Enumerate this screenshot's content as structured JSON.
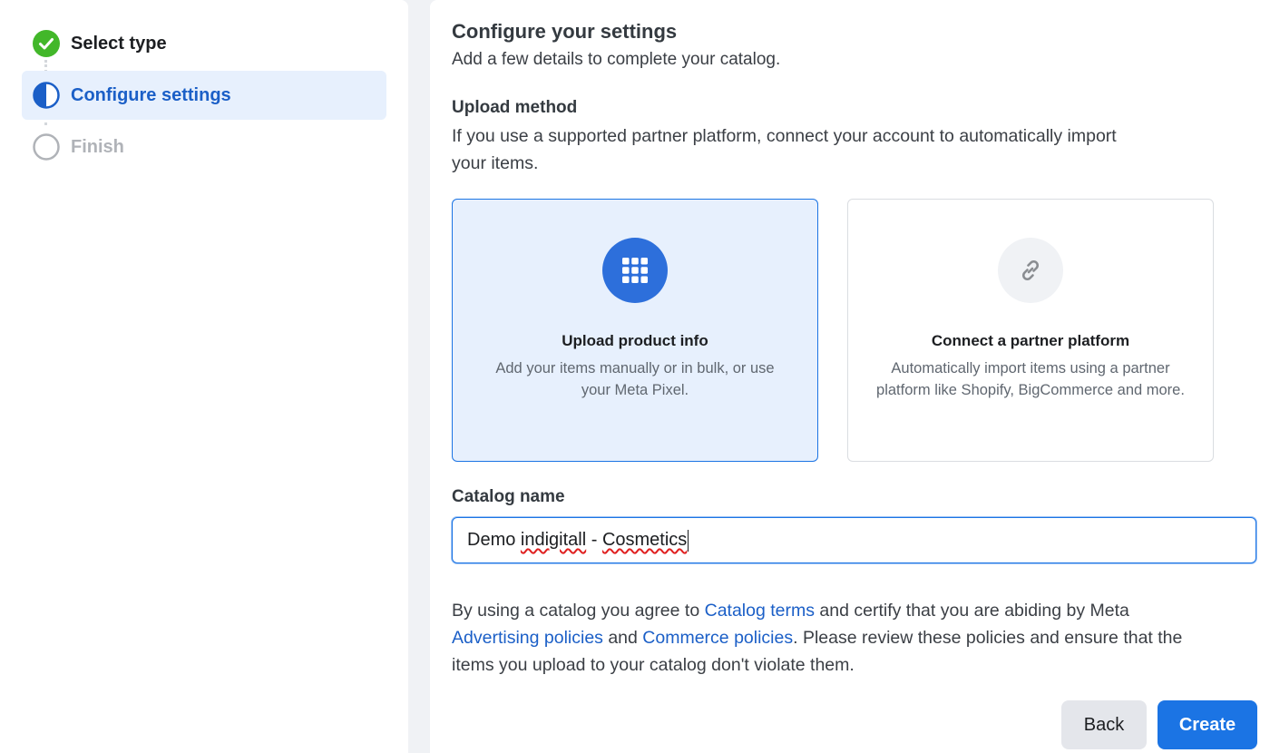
{
  "stepper": {
    "steps": [
      {
        "label": "Select type",
        "state": "done",
        "icon": "check-circle-icon"
      },
      {
        "label": "Configure settings",
        "state": "active",
        "icon": "half-circle-icon"
      },
      {
        "label": "Finish",
        "state": "todo",
        "icon": "empty-circle-icon"
      }
    ]
  },
  "main": {
    "title": "Configure your settings",
    "subtitle": "Add a few details to complete your catalog.",
    "upload_method": {
      "label": "Upload method",
      "description_line1": "If you use a supported partner platform, connect your account to automatically import",
      "description_line2": "your items.",
      "options": [
        {
          "title": "Upload product info",
          "description": "Add your items manually or in bulk, or use your Meta Pixel.",
          "icon": "grid-icon",
          "selected": true
        },
        {
          "title": "Connect a partner platform",
          "description": "Automatically import items using a partner platform like Shopify, BigCommerce and more.",
          "icon": "link-icon",
          "selected": false
        }
      ]
    },
    "catalog_name": {
      "label": "Catalog name",
      "value": "Demo indigitall - Cosmetics",
      "value_part1": "Demo ",
      "value_part2": "indigitall",
      "value_part3": " - ",
      "value_part4": "Cosmetics"
    },
    "terms": {
      "t1": "By using a catalog you agree to ",
      "link1": "Catalog terms",
      "t2": " and certify that you are abiding by Meta",
      "link2": "Advertising policies",
      "t3": " and ",
      "link3": "Commerce policies",
      "t4": ". Please review these policies and ensure that the",
      "t5": "items you upload to your catalog don't violate them."
    }
  },
  "footer": {
    "back_label": "Back",
    "create_label": "Create"
  },
  "colors": {
    "accent": "#1b74e4",
    "success": "#42b72a",
    "selected_bg": "#e7f0fd"
  }
}
